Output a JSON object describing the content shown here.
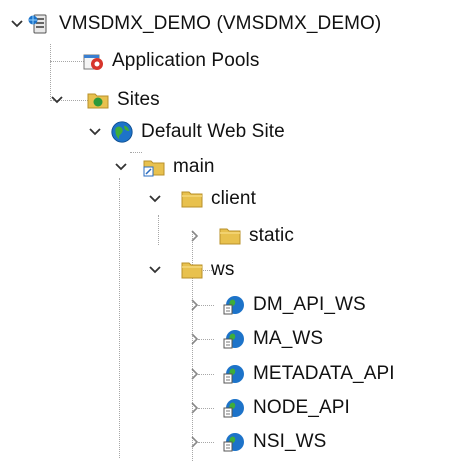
{
  "colors": {
    "guide_line": "#a7a7a7",
    "folder": "#e8c14e",
    "globe": "#1d73c9",
    "text": "#111111"
  },
  "tree": {
    "server": {
      "label": "VMSDMX_DEMO (VMSDMX_DEMO)",
      "icon": "server-icon",
      "expanded": true
    },
    "app_pools": {
      "label": "Application Pools",
      "icon": "application-pools-icon"
    },
    "sites": {
      "label": "Sites",
      "icon": "sites-icon",
      "expanded": true
    },
    "default_site": {
      "label": "Default Web Site",
      "icon": "globe-icon",
      "expanded": true
    },
    "main": {
      "label": "main",
      "icon": "application-folder-icon",
      "expanded": true
    },
    "client": {
      "label": "client",
      "icon": "folder-icon",
      "expanded": true
    },
    "static": {
      "label": "static",
      "icon": "folder-icon",
      "expanded": false
    },
    "ws": {
      "label": "ws",
      "icon": "folder-icon",
      "expanded": true
    },
    "ws_children": [
      {
        "label": "DM_API_WS",
        "icon": "web-application-icon",
        "expanded": false
      },
      {
        "label": "MA_WS",
        "icon": "web-application-icon",
        "expanded": false
      },
      {
        "label": "METADATA_API",
        "icon": "web-application-icon",
        "expanded": false
      },
      {
        "label": "NODE_API",
        "icon": "web-application-icon",
        "expanded": false
      },
      {
        "label": "NSI_WS",
        "icon": "web-application-icon",
        "expanded": false
      }
    ]
  }
}
